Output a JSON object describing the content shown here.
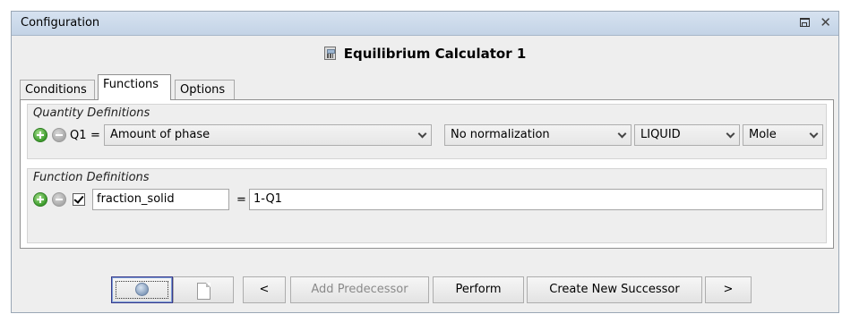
{
  "window": {
    "title": "Configuration",
    "maximize_icon": "maximize-icon",
    "close_icon": "close-icon",
    "close_glyph": "✕"
  },
  "heading": {
    "icon": "calculator-icon",
    "title": "Equilibrium Calculator 1"
  },
  "tabs": [
    {
      "label": "Conditions",
      "active": false
    },
    {
      "label": "Functions",
      "active": true
    },
    {
      "label": "Options",
      "active": false
    }
  ],
  "quantity_definitions": {
    "legend": "Quantity Definitions",
    "row": {
      "name": "Q1",
      "equals": "=",
      "quantity": "Amount of phase",
      "normalization": "No normalization",
      "phase": "LIQUID",
      "unit": "Mole"
    }
  },
  "function_definitions": {
    "legend": "Function Definitions",
    "row": {
      "checked": true,
      "name": "fraction_solid",
      "equals": "=",
      "expression": "1-Q1"
    }
  },
  "toolbar": {
    "help_icon": "help-icon",
    "document_icon": "document-icon",
    "prev_label": "<",
    "add_predecessor_label": "Add Predecessor",
    "perform_label": "Perform",
    "create_successor_label": "Create New Successor",
    "next_label": ">"
  },
  "colors": {
    "titlebar": "#c9d8ea",
    "add_button": "#3c9b2c",
    "remove_button": "#a9a9a9"
  }
}
